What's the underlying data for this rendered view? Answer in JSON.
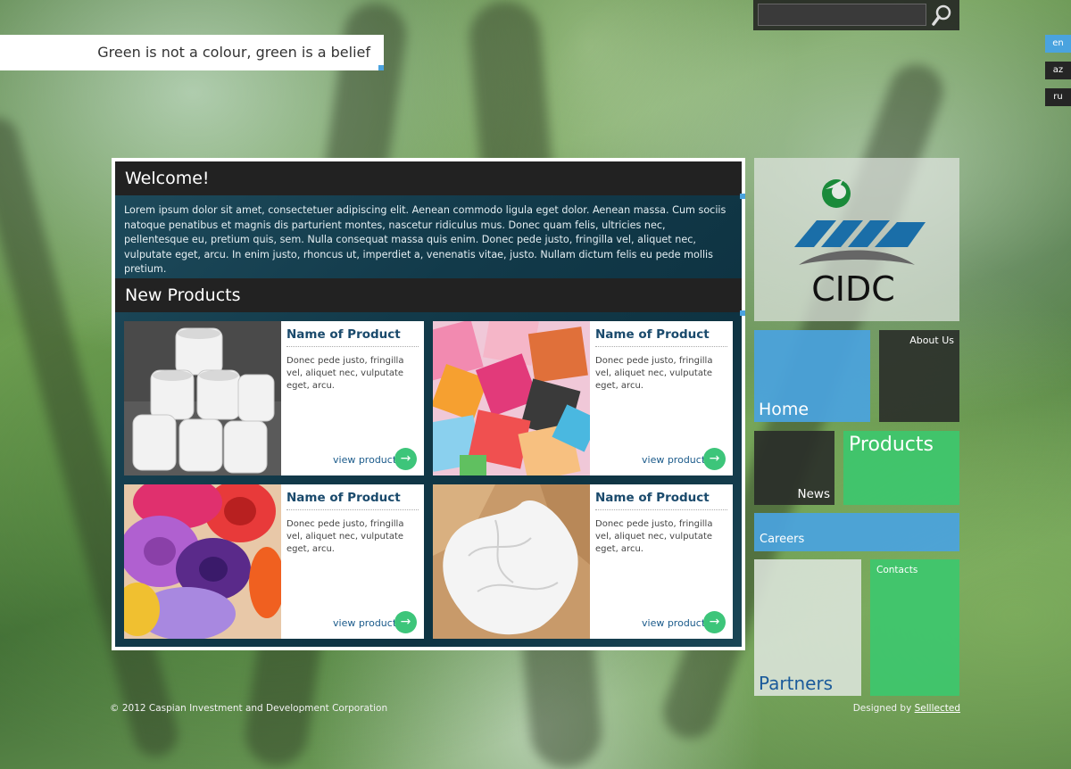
{
  "search": {
    "placeholder": "",
    "value": "",
    "icon": "search-icon"
  },
  "languages": [
    {
      "code": "en",
      "active": true
    },
    {
      "code": "az",
      "active": false
    },
    {
      "code": "ru",
      "active": false
    }
  ],
  "slogan": "Green is not a colour, green is a belief",
  "welcome": {
    "title": "Welcome!",
    "text": "Lorem ipsum dolor sit amet, consectetuer adipiscing elit. Aenean commodo ligula eget dolor. Aenean massa. Cum sociis natoque penatibus et magnis dis parturient montes, nascetur ridiculus mus. Donec quam felis, ultricies nec, pellentesque eu, pretium quis, sem. Nulla consequat massa quis enim. Donec pede justo, fringilla vel, aliquet nec, vulputate eget, arcu. In enim justo, rhoncus ut, imperdiet a, venenatis vitae, justo. Nullam dictum felis eu pede mollis pretium."
  },
  "products": {
    "title": "New Products",
    "items": [
      {
        "name": "Name of Product",
        "desc": "Donec pede justo, fringilla vel, aliquet nec, vulputate eget, arcu.",
        "link": "view product",
        "image": "toilet-paper-rolls"
      },
      {
        "name": "Name of Product",
        "desc": "Donec pede justo, fringilla vel, aliquet nec, vulputate eget, arcu.",
        "link": "view product",
        "image": "colored-tissue-squares"
      },
      {
        "name": "Name of Product",
        "desc": "Donec pede justo, fringilla vel, aliquet nec, vulputate eget, arcu.",
        "link": "view product",
        "image": "crepe-paper-rolls"
      },
      {
        "name": "Name of Product",
        "desc": "Donec pede justo, fringilla vel, aliquet nec, vulputate eget, arcu.",
        "link": "view product",
        "image": "tissue-in-box"
      }
    ]
  },
  "logo": {
    "text": "CIDC"
  },
  "tiles": {
    "home": "Home",
    "about": "About Us",
    "news": "News",
    "products": "Products",
    "careers": "Careers",
    "partners": "Partners",
    "contacts": "Contacts"
  },
  "footer": {
    "copyright": "© 2012 Caspian Investment and Development Corporation",
    "designed_by": "Designed by",
    "designer": "Selllected"
  },
  "colors": {
    "accent_blue": "#4aa3df",
    "accent_green": "#3dc57a",
    "dark_tile": "#282a28",
    "panel_teal": "#123a4a",
    "title_blue": "#1a4a6c"
  }
}
